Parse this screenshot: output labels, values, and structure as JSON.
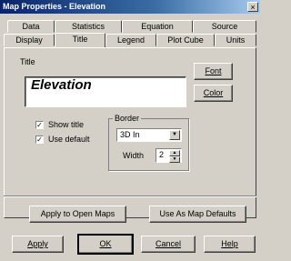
{
  "window": {
    "title": "Map Properties - Elevation",
    "close": "×"
  },
  "tabs_row1": [
    "Data",
    "Statistics",
    "Equation",
    "Source"
  ],
  "tabs_row2": [
    "Display",
    "Title",
    "Legend",
    "Plot Cube",
    "Units"
  ],
  "active_tab": "Title",
  "title_section": {
    "label": "Title",
    "value": "Elevation"
  },
  "buttons": {
    "font": "Font",
    "color": "Color",
    "apply_open": "Apply to Open Maps",
    "use_defaults": "Use As Map Defaults",
    "apply": "Apply",
    "ok": "OK",
    "cancel": "Cancel",
    "help": "Help"
  },
  "checkboxes": {
    "show_title": {
      "label": "Show title",
      "checked": true
    },
    "use_default": {
      "label": "Use default",
      "checked": true
    }
  },
  "border": {
    "group_label": "Border",
    "style_value": "3D In",
    "width_label": "Width",
    "width_value": "2"
  }
}
